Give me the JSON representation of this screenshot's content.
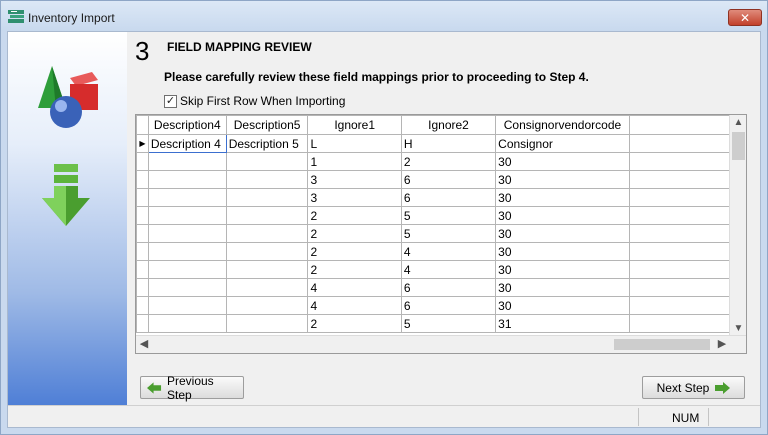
{
  "window": {
    "title": "Inventory Import",
    "close_label": "✕"
  },
  "step": {
    "number": "3",
    "title": "FIELD MAPPING REVIEW",
    "instruction": "Please carefully review these field mappings prior to proceeding to Step 4.",
    "skip_first_row_label": "Skip First Row When Importing",
    "skip_first_row_checked": true
  },
  "grid": {
    "columns": [
      "Description4",
      "Description5",
      "Ignore1",
      "Ignore2",
      "Consignorvendorcode",
      ""
    ],
    "rows": [
      [
        "Description 4",
        "Description 5",
        "L",
        "H",
        "Consignor",
        ""
      ],
      [
        "",
        "",
        "1",
        "2",
        "30",
        ""
      ],
      [
        "",
        "",
        "3",
        "6",
        "30",
        ""
      ],
      [
        "",
        "",
        "3",
        "6",
        "30",
        ""
      ],
      [
        "",
        "",
        "2",
        "5",
        "30",
        ""
      ],
      [
        "",
        "",
        "2",
        "5",
        "30",
        ""
      ],
      [
        "",
        "",
        "2",
        "4",
        "30",
        ""
      ],
      [
        "",
        "",
        "2",
        "4",
        "30",
        ""
      ],
      [
        "",
        "",
        "4",
        "6",
        "30",
        ""
      ],
      [
        "",
        "",
        "4",
        "6",
        "30",
        ""
      ],
      [
        "",
        "",
        "2",
        "5",
        "31",
        ""
      ]
    ],
    "selected_row": 0
  },
  "buttons": {
    "previous_label": "Previous Step",
    "next_label": "Next Step"
  },
  "statusbar": {
    "num_indicator": "NUM"
  },
  "colors": {
    "title_bar": "#c8d9ee",
    "close_button": "#c2412b",
    "side_panel_bottom": "#4f7fd6",
    "arrow_green": "#4a9e2f"
  },
  "icons": {
    "app": "inventory-icon",
    "side_top": "shapes-icon",
    "side_bottom": "download-arrow-icon",
    "prev": "left-arrow-icon",
    "next": "right-arrow-icon"
  }
}
